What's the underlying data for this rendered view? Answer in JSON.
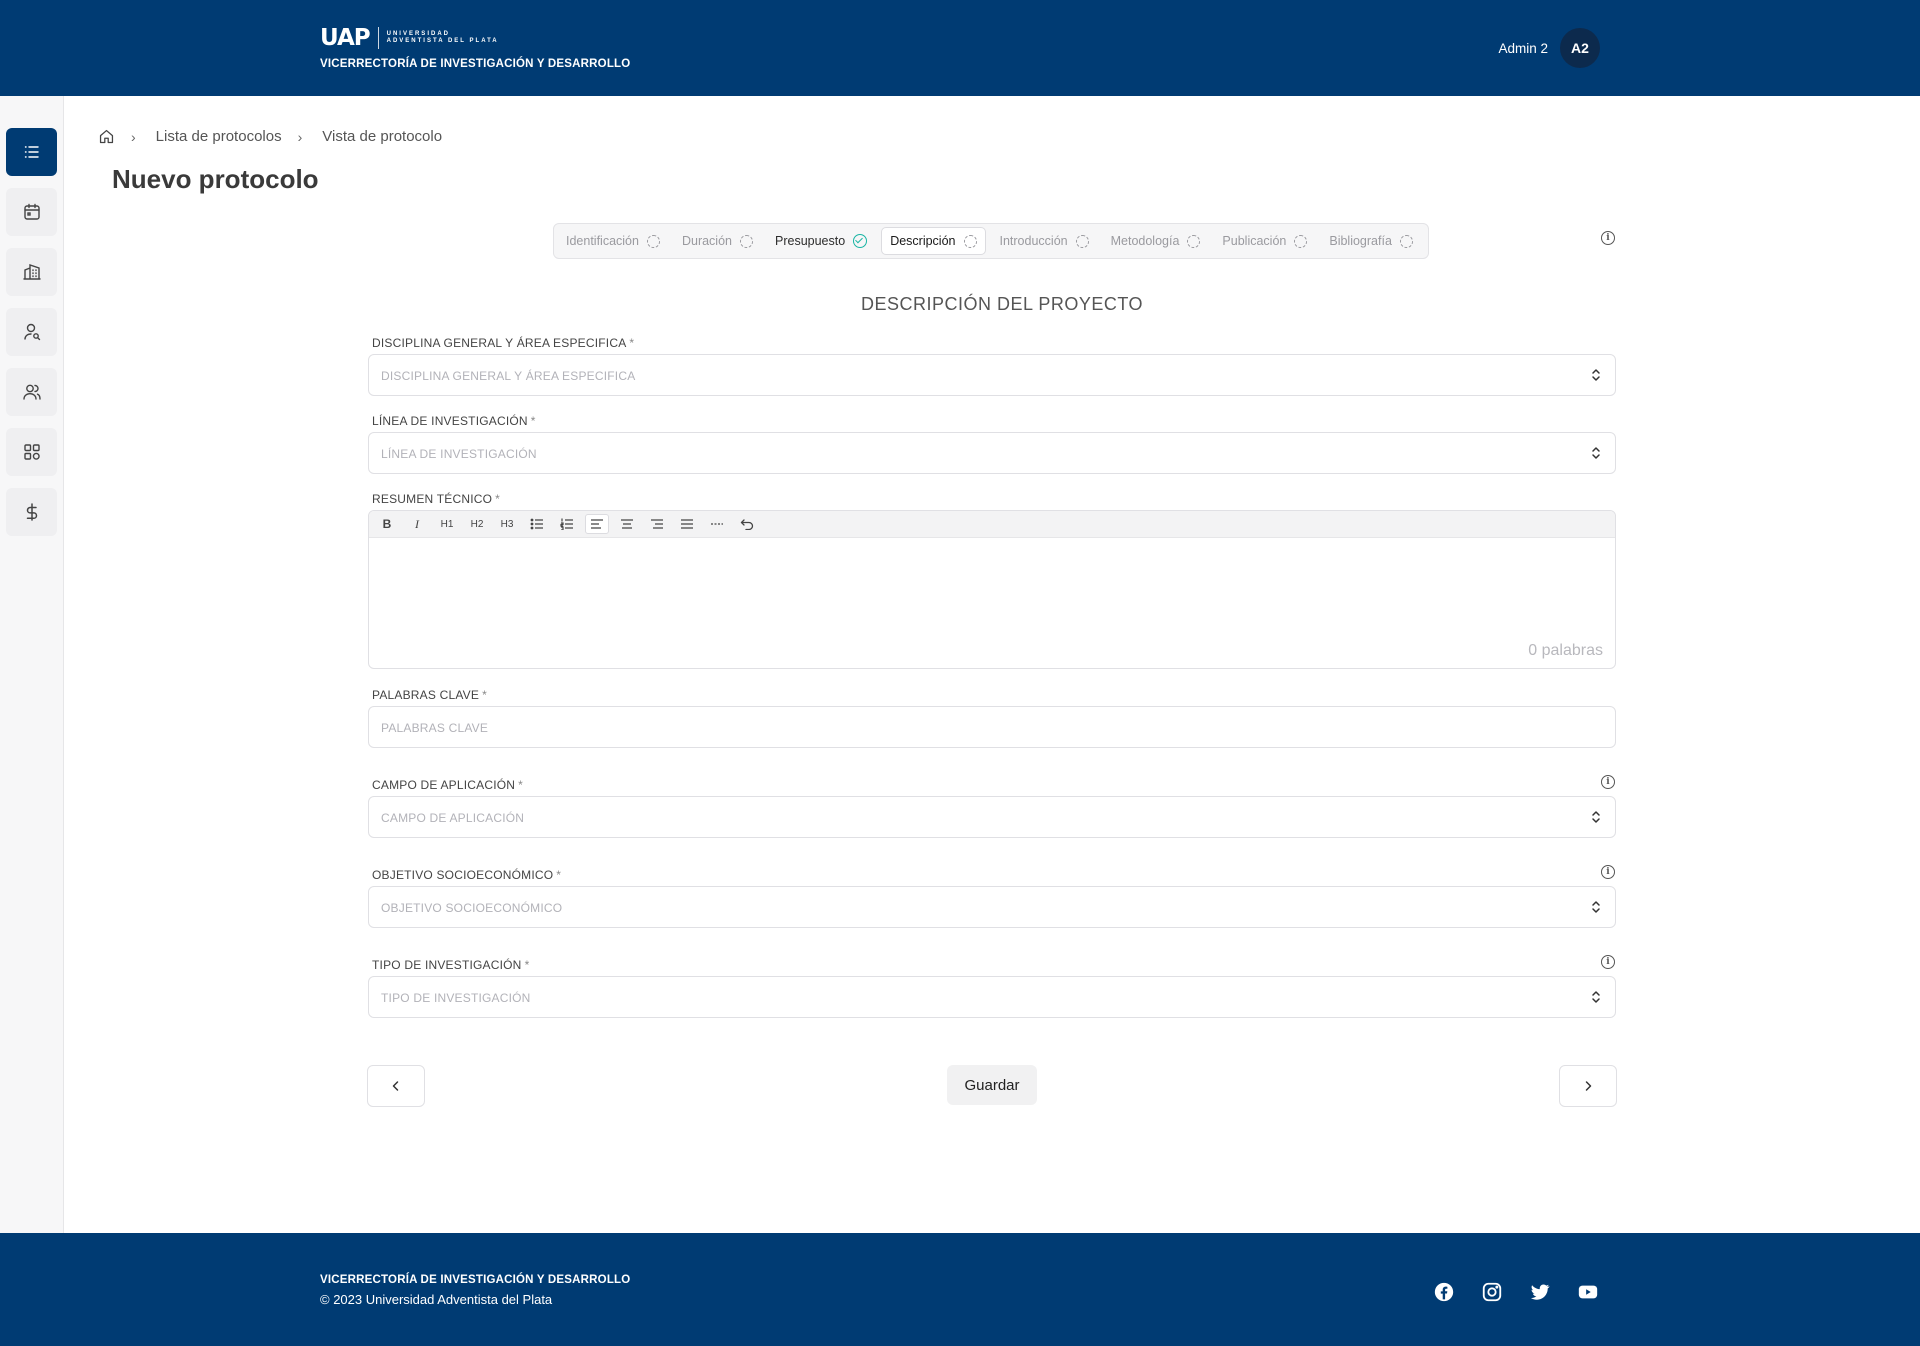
{
  "header": {
    "logo_text": "UAP",
    "logo_subtitle": "UNIVERSIDAD ADVENTISTA DEL PLATA",
    "org_name": "VICERRECTORÍA DE INVESTIGACIÓN Y DESARROLLO",
    "user_name": "Admin 2",
    "avatar_initials": "A2"
  },
  "sidebar": {
    "items": [
      {
        "icon": "list-icon",
        "active": true
      },
      {
        "icon": "calendar-icon",
        "active": false
      },
      {
        "icon": "building-icon",
        "active": false
      },
      {
        "icon": "user-search-icon",
        "active": false
      },
      {
        "icon": "users-icon",
        "active": false
      },
      {
        "icon": "grid-icon",
        "active": false
      },
      {
        "icon": "dollar-icon",
        "active": false
      }
    ]
  },
  "breadcrumb": {
    "home_icon": "home-icon",
    "items": [
      "Lista de protocolos",
      "Vista de protocolo"
    ]
  },
  "page_title": "Nuevo protocolo",
  "steps": [
    {
      "label": "Identificación",
      "status": "pending"
    },
    {
      "label": "Duración",
      "status": "pending"
    },
    {
      "label": "Presupuesto",
      "status": "done"
    },
    {
      "label": "Descripción",
      "status": "current"
    },
    {
      "label": "Introducción",
      "status": "pending"
    },
    {
      "label": "Metodología",
      "status": "pending"
    },
    {
      "label": "Publicación",
      "status": "pending"
    },
    {
      "label": "Bibliografía",
      "status": "pending"
    }
  ],
  "section_title": "DESCRIPCIÓN DEL PROYECTO",
  "required_mark": "*",
  "fields": {
    "disciplina": {
      "label": "DISCIPLINA GENERAL Y ÁREA ESPECIFICA",
      "placeholder": "DISCIPLINA GENERAL Y ÁREA ESPECIFICA"
    },
    "linea": {
      "label": "LÍNEA DE INVESTIGACIÓN",
      "placeholder": "LÍNEA DE INVESTIGACIÓN"
    },
    "resumen": {
      "label": "RESUMEN TÉCNICO",
      "word_count": "0 palabras"
    },
    "palabras": {
      "label": "PALABRAS CLAVE",
      "placeholder": "PALABRAS CLAVE"
    },
    "campo": {
      "label": "CAMPO DE APLICACIÓN",
      "placeholder": "CAMPO DE APLICACIÓN"
    },
    "objetivo": {
      "label": "OBJETIVO SOCIOECONÓMICO",
      "placeholder": "OBJETIVO SOCIOECONÓMICO"
    },
    "tipo": {
      "label": "TIPO DE INVESTIGACIÓN",
      "placeholder": "TIPO DE INVESTIGACIÓN"
    }
  },
  "toolbar": {
    "bold": "B",
    "italic": "I",
    "h1": "H1",
    "h2": "H2",
    "h3": "H3"
  },
  "actions": {
    "save_label": "Guardar",
    "prev_icon": "chevron-left-icon",
    "next_icon": "chevron-right-icon"
  },
  "footer": {
    "org_name": "VICERRECTORÍA DE INVESTIGACIÓN Y DESARROLLO",
    "copyright": "© 2023 Universidad Adventista del Plata",
    "social": [
      "facebook-icon",
      "instagram-icon",
      "twitter-icon",
      "youtube-icon"
    ]
  },
  "colors": {
    "brand": "#003b73",
    "success": "#19b5a4"
  }
}
